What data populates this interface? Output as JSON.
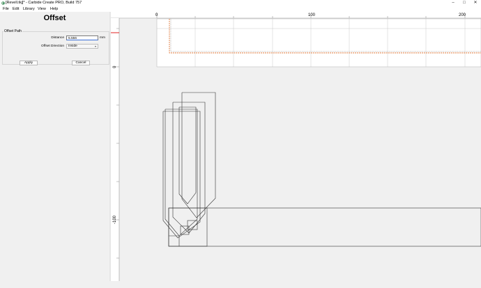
{
  "window": {
    "title": "[Revell.tkj]* - Carbide Create PRO, Build 757",
    "icon": "carbide-create-app-icon",
    "buttons": {
      "minimize": "–",
      "maximize": "□",
      "close": "✕"
    }
  },
  "menu": {
    "items": [
      {
        "label": "File",
        "mnemonic": "F"
      },
      {
        "label": "Edit",
        "mnemonic": "E"
      },
      {
        "label": "Library",
        "mnemonic": "L"
      },
      {
        "label": "View",
        "mnemonic": "V"
      },
      {
        "label": "Help",
        "mnemonic": "H"
      }
    ]
  },
  "panel": {
    "title": "Offset",
    "group_label": "Offset Path",
    "distance_label": "Distance",
    "distance_value": "5.556",
    "distance_unit": "mm",
    "direction_label": "Offset Direction",
    "direction_value": "Inside",
    "apply_label": "Apply",
    "cancel_label": "Cancel"
  },
  "rulers": {
    "top_ticks": [
      "0",
      "100",
      "200"
    ],
    "left_ticks": [
      "0",
      "-100"
    ]
  },
  "colors": {
    "canvas_bg": "#f0f0f0",
    "stock": "#ffffff",
    "grid": "#b4b4b4",
    "stock_outline": "#e07a3a",
    "origin_marker": "#e02020",
    "vectors": "#303030",
    "ruler_bg": "#ffffff"
  }
}
